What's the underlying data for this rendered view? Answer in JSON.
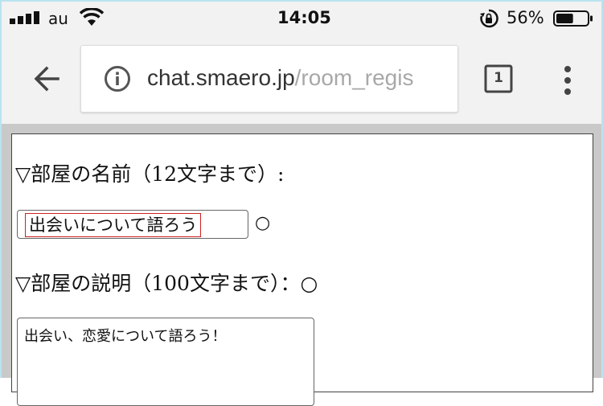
{
  "status_bar": {
    "carrier": "au",
    "time": "14:05",
    "battery_percent": "56%",
    "battery_level": 0.56
  },
  "browser": {
    "url_host": "chat.smaero.jp",
    "url_path": "/room_regis",
    "tab_count": "1"
  },
  "form": {
    "name_label": "▽部屋の名前（12文字まで）:",
    "name_value": "出会いについて語ろう",
    "name_mark": "○",
    "description_label": "▽部屋の説明（100文字まで）：○",
    "description_value": "出会い、恋愛について語ろう！"
  },
  "colors": {
    "chrome_bg": "#f2f2f2",
    "frame_border": "#b9e4ef",
    "field_highlight": "#cc2222"
  },
  "icons": {
    "signal": "signal-bars-icon",
    "wifi": "wifi-icon",
    "rotation_lock": "rotation-lock-icon",
    "battery": "battery-icon",
    "back": "back-arrow-icon",
    "info": "info-icon",
    "tabs": "tab-switcher-icon",
    "menu": "more-vert-icon"
  }
}
